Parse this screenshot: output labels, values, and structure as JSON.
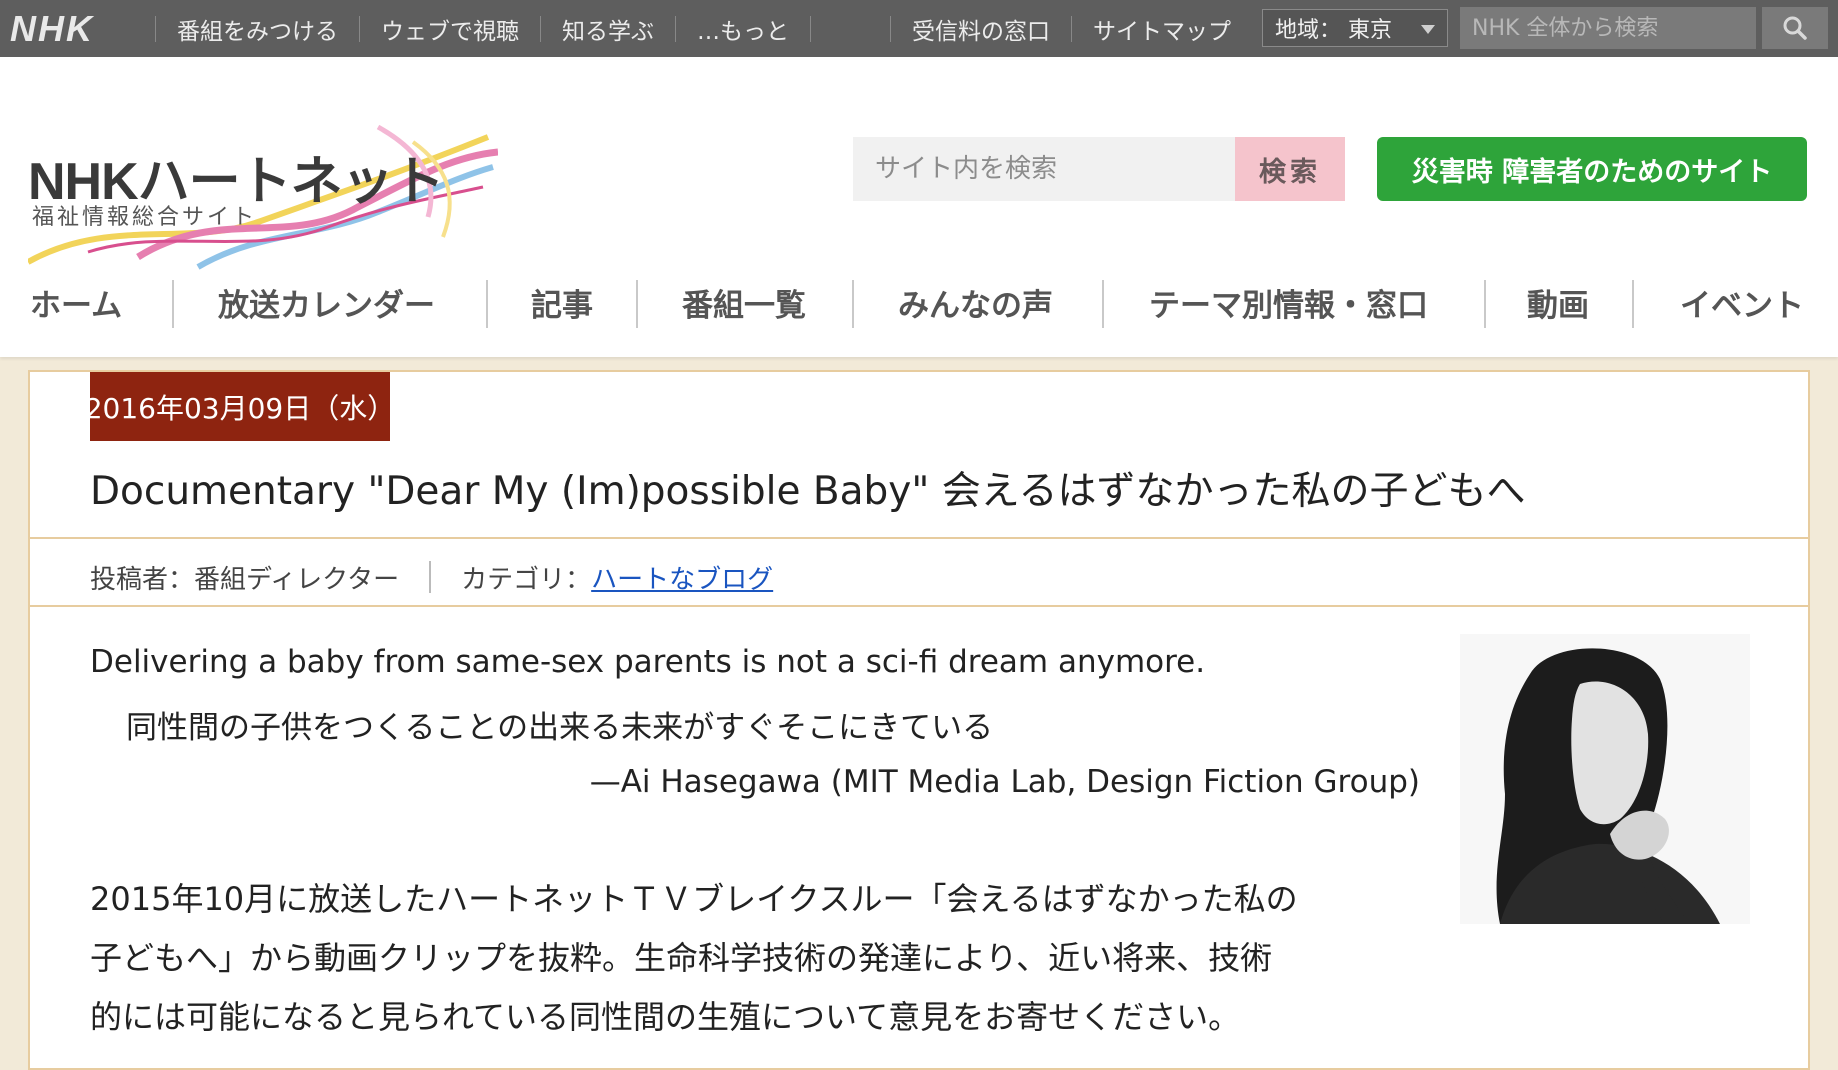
{
  "topbar": {
    "logo": "NHK",
    "left_links": [
      "番組をみつける",
      "ウェブで視聴",
      "知る学ぶ",
      "…もっと"
    ],
    "right_links": [
      "受信料の窓口",
      "サイトマップ"
    ],
    "region": "地域： 東京",
    "search_placeholder": "NHK 全体から検索",
    "search_icon": "search-icon"
  },
  "header": {
    "logo_main": "NHKハートネット",
    "logo_sub": "福祉情報総合サイト",
    "site_search_placeholder": "サイト内を検索",
    "site_search_button": "検索",
    "disaster_button": "災害時 障害者のためのサイト"
  },
  "nav": {
    "items": [
      "ホーム",
      "放送カレンダー",
      "記事",
      "番組一覧",
      "みんなの声",
      "テーマ別情報・窓口",
      "動画",
      "イベント"
    ]
  },
  "article": {
    "date": "2016年03月09日（水）",
    "title": "Documentary \"Dear My (Im)possible Baby\" 会えるはずなかった私の子どもへ",
    "author": "投稿者：番組ディレクター",
    "category_label": "カテゴリ：",
    "category_link": "ハートなブログ",
    "quote_en": "Delivering a baby from same-sex parents is not a sci-fi dream anymore.",
    "quote_ja": "同性間の子供をつくることの出来る未来がすぐそこにきている",
    "quote_attribution": "—Ai Hasegawa (MIT Media Lab, Design Fiction Group)",
    "body": [
      "2015年10月に放送したハートネットＴＶブレイクスルー「会えるはずなかった私の",
      "子どもへ」から動画クリップを抜粋。生命科学技術の発達により、近い将来、技術",
      "的には可能になると見られている同性間の生殖について意見をお寄せください。"
    ]
  }
}
